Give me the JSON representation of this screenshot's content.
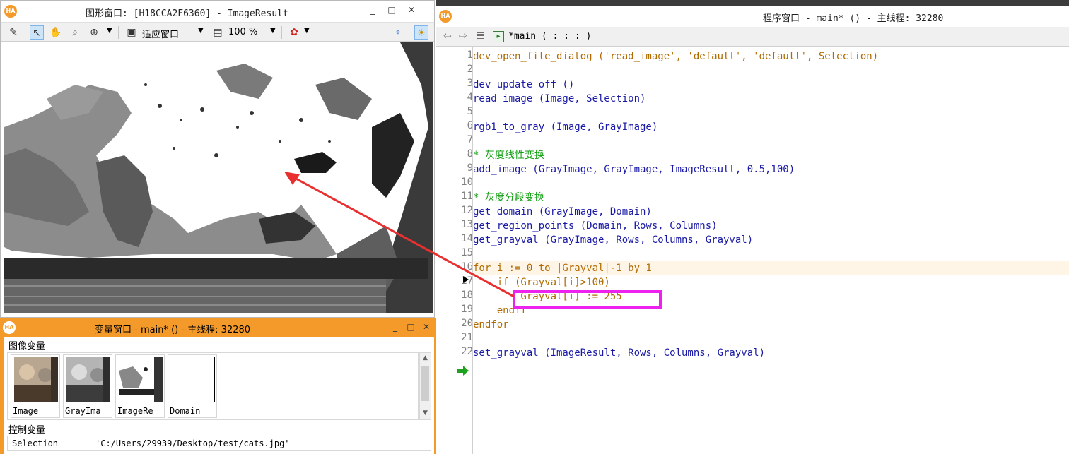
{
  "graphics_window": {
    "title": "图形窗口: [H18CCA2F6360] - ImageResult",
    "toolbar": {
      "fit_label": "适应窗口",
      "zoom_value": "100 %"
    }
  },
  "variable_window": {
    "title": "变量窗口 - main* () - 主线程: 32280",
    "image_section_label": "图像变量",
    "image_vars": [
      {
        "name": "Image"
      },
      {
        "name": "GrayIma"
      },
      {
        "name": "ImageRe"
      },
      {
        "name": "Domain"
      }
    ],
    "control_section_label": "控制变量",
    "control_vars": [
      {
        "name": "Selection",
        "value": "'C:/Users/29939/Desktop/test/cats.jpg'"
      }
    ]
  },
  "program_window": {
    "title": "程序窗口 - main* () - 主线程: 32280",
    "procedure_label": "*main ( : : : )",
    "line_numbers": [
      "1",
      "2",
      "3",
      "4",
      "5",
      "6",
      "7",
      "8",
      "9",
      "10",
      "11",
      "12",
      "13",
      "14",
      "15",
      "16",
      "17",
      "18",
      "19",
      "20",
      "21",
      "22"
    ],
    "lines": {
      "l1": "dev_open_file_dialog ('read_image', 'default', 'default', Selection)",
      "l2": "",
      "l3": "dev_update_off ()",
      "l4": "read_image (Image, Selection)",
      "l5": "",
      "l6": "rgb1_to_gray (Image, GrayImage)",
      "l7": "",
      "l8": "* 灰度线性变换",
      "l9": "add_image (GrayImage, GrayImage, ImageResult, 0.5,100)",
      "l10": "",
      "l11": "* 灰度分段变换",
      "l12": "get_domain (GrayImage, Domain)",
      "l13": "get_region_points (Domain, Rows, Columns)",
      "l14": "get_grayval (GrayImage, Rows, Columns, Grayval)",
      "l15": "",
      "l16": "for i := 0 to |Grayval|-1 by 1",
      "l17": "    if (Grayval[i]>100)",
      "l18": "        Grayval[i] := 255",
      "l19": "    endif",
      "l20": "endfor",
      "l21": "",
      "l22": "set_grayval (ImageResult, Rows, Columns, Grayval)"
    }
  },
  "colors": {
    "accent_orange": "#f39a2b",
    "annotation_magenta": "#ee22ee",
    "annotation_red": "#e83030",
    "code_blue": "#1a1aa6",
    "comment_green": "#14a014",
    "keyword_orange": "#b06b00"
  },
  "icons": [
    "halcon-logo-icon",
    "edit-icon",
    "pointer-icon",
    "hand-pan-icon",
    "magnifier-icon",
    "zoom-in-icon",
    "fit-window-icon",
    "zoom-icon",
    "color-palette-icon",
    "roi-icon",
    "lightbulb-icon",
    "back-arrow-icon",
    "forward-arrow-icon",
    "clipboard-icon",
    "procedure-icon",
    "pc-arrow-icon"
  ]
}
